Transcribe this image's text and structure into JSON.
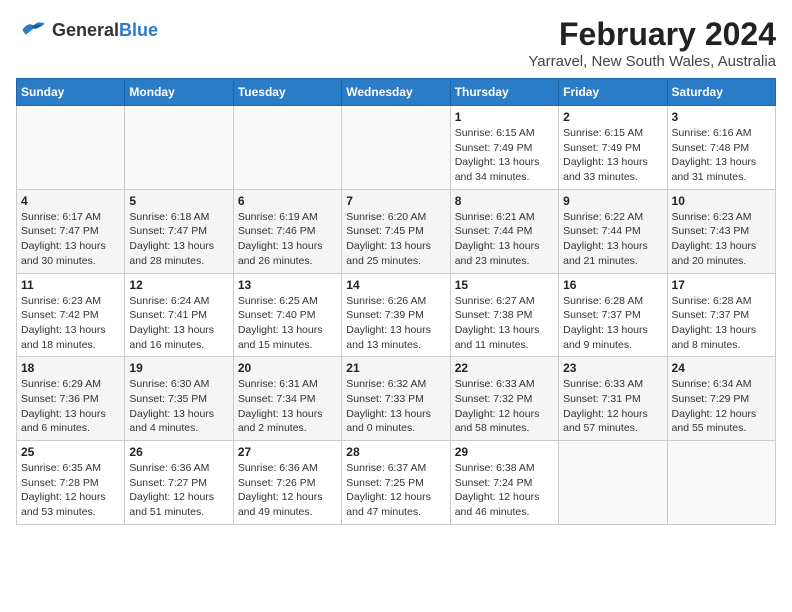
{
  "header": {
    "logo_general": "General",
    "logo_blue": "Blue",
    "month_year": "February 2024",
    "location": "Yarravel, New South Wales, Australia"
  },
  "days_of_week": [
    "Sunday",
    "Monday",
    "Tuesday",
    "Wednesday",
    "Thursday",
    "Friday",
    "Saturday"
  ],
  "weeks": [
    {
      "days": [
        {
          "num": "",
          "info": ""
        },
        {
          "num": "",
          "info": ""
        },
        {
          "num": "",
          "info": ""
        },
        {
          "num": "",
          "info": ""
        },
        {
          "num": "1",
          "info": "Sunrise: 6:15 AM\nSunset: 7:49 PM\nDaylight: 13 hours\nand 34 minutes."
        },
        {
          "num": "2",
          "info": "Sunrise: 6:15 AM\nSunset: 7:49 PM\nDaylight: 13 hours\nand 33 minutes."
        },
        {
          "num": "3",
          "info": "Sunrise: 6:16 AM\nSunset: 7:48 PM\nDaylight: 13 hours\nand 31 minutes."
        }
      ]
    },
    {
      "days": [
        {
          "num": "4",
          "info": "Sunrise: 6:17 AM\nSunset: 7:47 PM\nDaylight: 13 hours\nand 30 minutes."
        },
        {
          "num": "5",
          "info": "Sunrise: 6:18 AM\nSunset: 7:47 PM\nDaylight: 13 hours\nand 28 minutes."
        },
        {
          "num": "6",
          "info": "Sunrise: 6:19 AM\nSunset: 7:46 PM\nDaylight: 13 hours\nand 26 minutes."
        },
        {
          "num": "7",
          "info": "Sunrise: 6:20 AM\nSunset: 7:45 PM\nDaylight: 13 hours\nand 25 minutes."
        },
        {
          "num": "8",
          "info": "Sunrise: 6:21 AM\nSunset: 7:44 PM\nDaylight: 13 hours\nand 23 minutes."
        },
        {
          "num": "9",
          "info": "Sunrise: 6:22 AM\nSunset: 7:44 PM\nDaylight: 13 hours\nand 21 minutes."
        },
        {
          "num": "10",
          "info": "Sunrise: 6:23 AM\nSunset: 7:43 PM\nDaylight: 13 hours\nand 20 minutes."
        }
      ]
    },
    {
      "days": [
        {
          "num": "11",
          "info": "Sunrise: 6:23 AM\nSunset: 7:42 PM\nDaylight: 13 hours\nand 18 minutes."
        },
        {
          "num": "12",
          "info": "Sunrise: 6:24 AM\nSunset: 7:41 PM\nDaylight: 13 hours\nand 16 minutes."
        },
        {
          "num": "13",
          "info": "Sunrise: 6:25 AM\nSunset: 7:40 PM\nDaylight: 13 hours\nand 15 minutes."
        },
        {
          "num": "14",
          "info": "Sunrise: 6:26 AM\nSunset: 7:39 PM\nDaylight: 13 hours\nand 13 minutes."
        },
        {
          "num": "15",
          "info": "Sunrise: 6:27 AM\nSunset: 7:38 PM\nDaylight: 13 hours\nand 11 minutes."
        },
        {
          "num": "16",
          "info": "Sunrise: 6:28 AM\nSunset: 7:37 PM\nDaylight: 13 hours\nand 9 minutes."
        },
        {
          "num": "17",
          "info": "Sunrise: 6:28 AM\nSunset: 7:37 PM\nDaylight: 13 hours\nand 8 minutes."
        }
      ]
    },
    {
      "days": [
        {
          "num": "18",
          "info": "Sunrise: 6:29 AM\nSunset: 7:36 PM\nDaylight: 13 hours\nand 6 minutes."
        },
        {
          "num": "19",
          "info": "Sunrise: 6:30 AM\nSunset: 7:35 PM\nDaylight: 13 hours\nand 4 minutes."
        },
        {
          "num": "20",
          "info": "Sunrise: 6:31 AM\nSunset: 7:34 PM\nDaylight: 13 hours\nand 2 minutes."
        },
        {
          "num": "21",
          "info": "Sunrise: 6:32 AM\nSunset: 7:33 PM\nDaylight: 13 hours\nand 0 minutes."
        },
        {
          "num": "22",
          "info": "Sunrise: 6:33 AM\nSunset: 7:32 PM\nDaylight: 12 hours\nand 58 minutes."
        },
        {
          "num": "23",
          "info": "Sunrise: 6:33 AM\nSunset: 7:31 PM\nDaylight: 12 hours\nand 57 minutes."
        },
        {
          "num": "24",
          "info": "Sunrise: 6:34 AM\nSunset: 7:29 PM\nDaylight: 12 hours\nand 55 minutes."
        }
      ]
    },
    {
      "days": [
        {
          "num": "25",
          "info": "Sunrise: 6:35 AM\nSunset: 7:28 PM\nDaylight: 12 hours\nand 53 minutes."
        },
        {
          "num": "26",
          "info": "Sunrise: 6:36 AM\nSunset: 7:27 PM\nDaylight: 12 hours\nand 51 minutes."
        },
        {
          "num": "27",
          "info": "Sunrise: 6:36 AM\nSunset: 7:26 PM\nDaylight: 12 hours\nand 49 minutes."
        },
        {
          "num": "28",
          "info": "Sunrise: 6:37 AM\nSunset: 7:25 PM\nDaylight: 12 hours\nand 47 minutes."
        },
        {
          "num": "29",
          "info": "Sunrise: 6:38 AM\nSunset: 7:24 PM\nDaylight: 12 hours\nand 46 minutes."
        },
        {
          "num": "",
          "info": ""
        },
        {
          "num": "",
          "info": ""
        }
      ]
    }
  ]
}
